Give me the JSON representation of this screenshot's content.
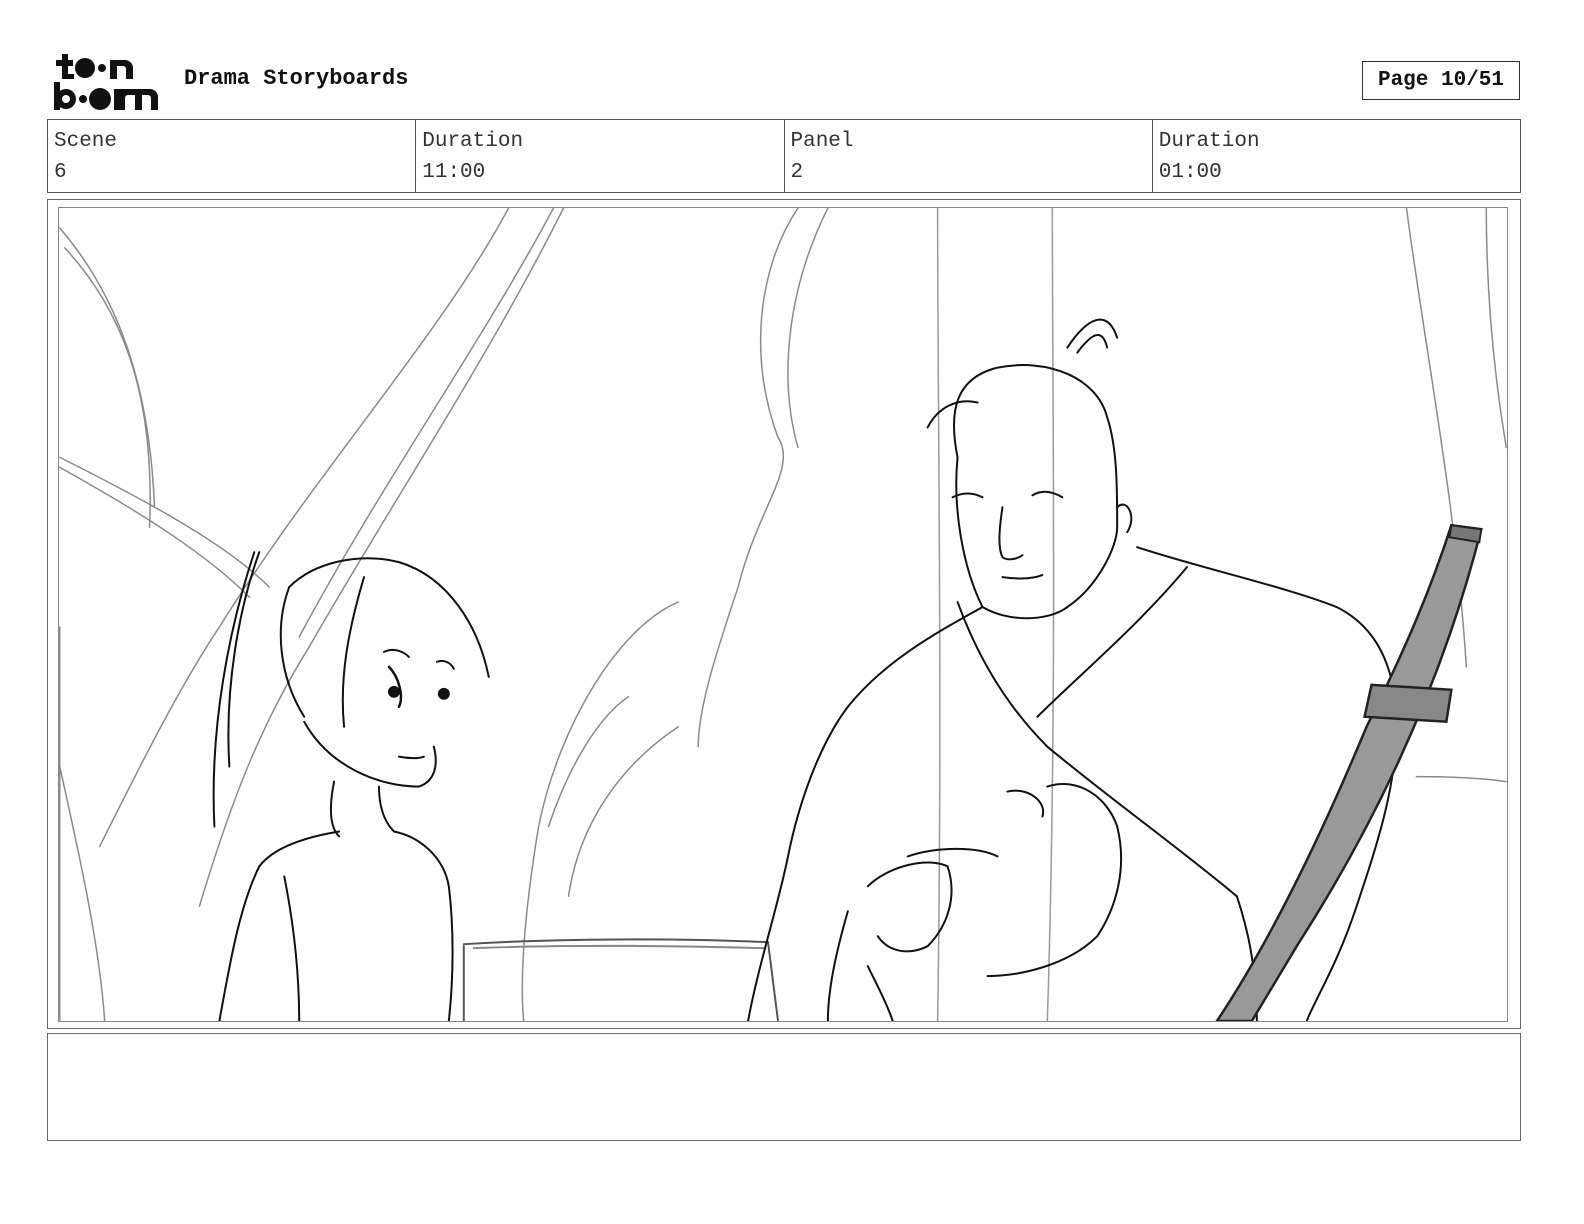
{
  "header": {
    "logo_text": "toon boom",
    "title": "Drama Storyboards",
    "page_label": "Page",
    "page_value": "10/51"
  },
  "info": {
    "scene_label": "Scene",
    "scene_value": "6",
    "duration_label": "Duration",
    "duration_value": "11:00",
    "panel_label": "Panel",
    "panel_value": "2",
    "panel_duration_label": "Duration",
    "panel_duration_value": "01:00"
  },
  "panel": {
    "image_icon": "storyboard-sketch-icon"
  },
  "notes": {
    "text": ""
  }
}
